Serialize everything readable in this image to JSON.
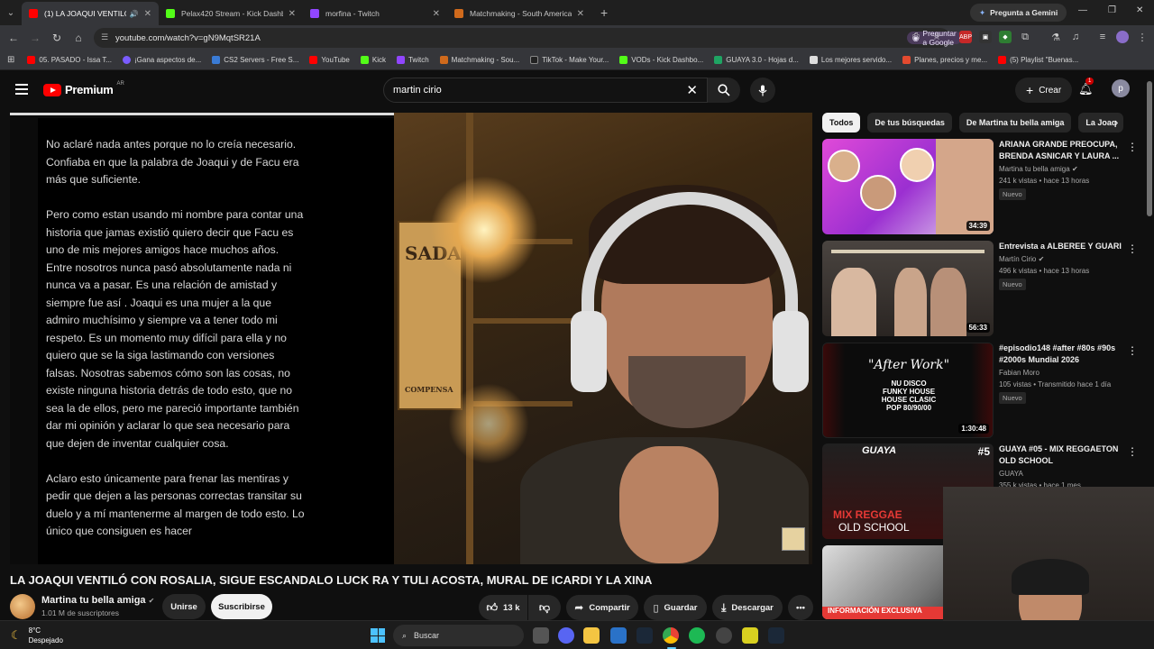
{
  "browser": {
    "tabs": [
      {
        "title": "(1) LA JOAQUI VENTILÓ CO",
        "active": true,
        "favicon_color": "#ff0000"
      },
      {
        "title": "Pelax420 Stream - Kick Dashbo",
        "active": false,
        "favicon_color": "#53fc18"
      },
      {
        "title": "morfina - Twitch",
        "active": false,
        "favicon_color": "#9146ff"
      },
      {
        "title": "Matchmaking - South America",
        "active": false,
        "favicon_color": "#d06a1c"
      }
    ],
    "new_tab_icon": "+",
    "gemini_label": "Pregunta a Gemini",
    "url": "youtube.com/watch?v=gN9MqtSR21A",
    "ask_google_label": "Preguntar a Google",
    "bookmarks": [
      {
        "label": "05. PASADO - Issa T...",
        "color": "#ff0000"
      },
      {
        "label": "¡Gana aspectos de...",
        "color": "#7a5cff"
      },
      {
        "label": "CS2 Servers - Free S...",
        "color": "#3a7bd5"
      },
      {
        "label": "YouTube",
        "color": "#ff0000"
      },
      {
        "label": "Kick",
        "color": "#53fc18"
      },
      {
        "label": "Twitch",
        "color": "#9146ff"
      },
      {
        "label": "Matchmaking - Sou...",
        "color": "#d06a1c"
      },
      {
        "label": "TikTok - Make Your...",
        "color": "#222222"
      },
      {
        "label": "VODs - Kick Dashbo...",
        "color": "#53fc18"
      },
      {
        "label": "GUAYA 3.0 - Hojas d...",
        "color": "#1fa463"
      },
      {
        "label": "Los mejores servido...",
        "color": "#dddddd"
      },
      {
        "label": "Planes, precios y me...",
        "color": "#e34a2f"
      },
      {
        "label": "(5) Playlist \"Buenas...",
        "color": "#ff0000"
      }
    ]
  },
  "header": {
    "logo_text": "Premium",
    "country": "AR",
    "search_value": "martin cirio",
    "create_label": "Crear",
    "notification_count": "1",
    "avatar_letter": "p"
  },
  "video": {
    "statement_paragraphs": [
      "No aclaré nada antes porque no lo creía necesario. Confiaba en que la palabra de Joaqui y de Facu era más que suficiente.",
      "Pero como estan usando mi nombre para contar una historia que  jamas existió quiero decir que Facu es uno de mis mejores amigos hace muchos años. Entre nosotros nunca pasó absolutamente nada ni nunca va a pasar. Es una relación de amistad y  siempre fue así . Joaqui es una mujer a la que admiro muchísimo y siempre va a tener todo mi respeto. Es un momento muy difícil para ella y no quiero que se la siga lastimando con versiones falsas. Nosotras sabemos cómo son las cosas,  no existe ninguna historia detrás de todo esto, que no sea la de ellos, pero me pareció importante también dar mi opinión y aclarar lo que sea necesario para que dejen de inventar cualquier cosa.",
      "Aclaro esto únicamente para frenar las mentiras y pedir que dejen a las personas correctas transitar su duelo y a mí mantenerme al margen de todo esto. Lo único que consiguen es hacer"
    ],
    "poster_text": "SADA",
    "poster_sub": "COMPENSA",
    "title": "LA JOAQUI VENTILÓ CON ROSALIA, SIGUE ESCANDALO LUCK RA Y TULI ACOSTA, MURAL DE ICARDI Y LA XINA",
    "channel_name": "Martina tu bella amiga",
    "subscribers": "1.01 M de suscriptores",
    "join_label": "Unirse",
    "subscribe_label": "Suscribirse",
    "likes": "13 k",
    "share_label": "Compartir",
    "save_label": "Guardar",
    "download_label": "Descargar"
  },
  "sidebar": {
    "chips": [
      "Todos",
      "De tus búsquedas",
      "De Martina tu bella amiga",
      "La Joaq"
    ],
    "recommendations": [
      {
        "title": "ARIANA GRANDE PREOCUPA, BRENDA ASNICAR Y LAURA ...",
        "channel": "Martina tu bella amiga",
        "verified": true,
        "meta": "241 k vistas • hace 13 horas",
        "badge": "Nuevo",
        "duration": "34:39",
        "thumb_color": "#c23fd6"
      },
      {
        "title": "Entrevista a ALBEREE Y GUARI",
        "channel": "Martín Cirio",
        "verified": true,
        "meta": "496 k vistas • hace 13 horas",
        "badge": "Nuevo",
        "duration": "56:33",
        "thumb_color": "#3a3430"
      },
      {
        "title": "#episodio148 #after #80s #90s #2000s Mundial 2026",
        "channel": "Fabian Moro",
        "verified": false,
        "meta": "105 vistas • Transmitido hace 1 día",
        "badge": "Nuevo",
        "duration": "1:30:48",
        "thumb_color": "#111111"
      },
      {
        "title": "GUAYA #05 - MIX REGGAETON OLD SCHOOL",
        "channel": "GUAYA",
        "verified": false,
        "meta": "355 k vistas • hace 1 mes",
        "badge": "",
        "duration": "",
        "thumb_color": "#1a1a1a"
      }
    ],
    "thumb_texts": {
      "after_work": "\"After Work\"",
      "after_lines": "NU DISCO\nFUNKY HOUSE\nHOUSE CLASIC\nPOP 80/90/00",
      "guaya_logo": "GUAYA",
      "guaya_num": "#5",
      "mix_reggae": "MIX REGGAE",
      "old_school": "OLD SCHOOL",
      "info_exclusiva": "INFORMACIÓN EXCLUSIVA"
    }
  },
  "taskbar": {
    "temperature": "8°C",
    "condition": "Despejado",
    "search_label": "Buscar"
  }
}
